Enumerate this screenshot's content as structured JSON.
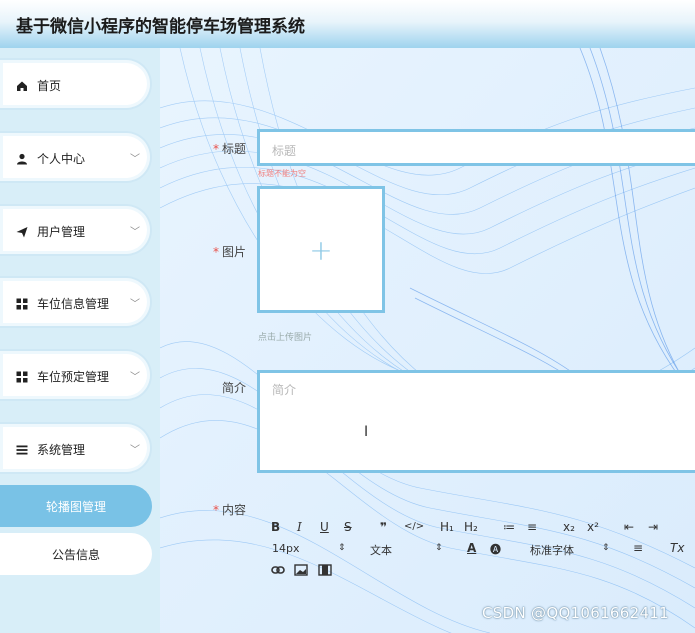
{
  "app": {
    "title": "基于微信小程序的智能停车场管理系统"
  },
  "sidebar": {
    "items": [
      {
        "label": "首页",
        "icon": "home-icon",
        "has_arrow": false
      },
      {
        "label": "个人中心",
        "icon": "user-icon",
        "has_arrow": true
      },
      {
        "label": "用户管理",
        "icon": "send-icon",
        "has_arrow": true
      },
      {
        "label": "车位信息管理",
        "icon": "grid-icon",
        "has_arrow": true
      },
      {
        "label": "车位预定管理",
        "icon": "grid-icon",
        "has_arrow": true
      },
      {
        "label": "系统管理",
        "icon": "list-icon",
        "has_arrow": true
      }
    ],
    "subitems": [
      {
        "label": "轮播图管理",
        "active": true
      },
      {
        "label": "公告信息",
        "active": false
      }
    ]
  },
  "form": {
    "title": {
      "label": "标题",
      "placeholder": "标题",
      "error": "标题不能为空",
      "required": true
    },
    "image": {
      "label": "图片",
      "hint": "点击上传图片",
      "required": true
    },
    "intro": {
      "label": "简介",
      "placeholder": "简介",
      "required": false
    },
    "content": {
      "label": "内容",
      "required": true
    }
  },
  "editor": {
    "row1": [
      "B",
      "I",
      "U",
      "S",
      "❞",
      "</>",
      "H₁",
      "H₂",
      "≔",
      "≡",
      "x₂",
      "x²",
      "⇤",
      "⇥"
    ],
    "font_size": "14px",
    "text_type": "文本",
    "font_family": "标准字体"
  },
  "watermark": "CSDN @QQ1061662411",
  "colors": {
    "accent": "#7fc4e6",
    "active_menu": "#79c2e6",
    "required": "#e8504a"
  }
}
